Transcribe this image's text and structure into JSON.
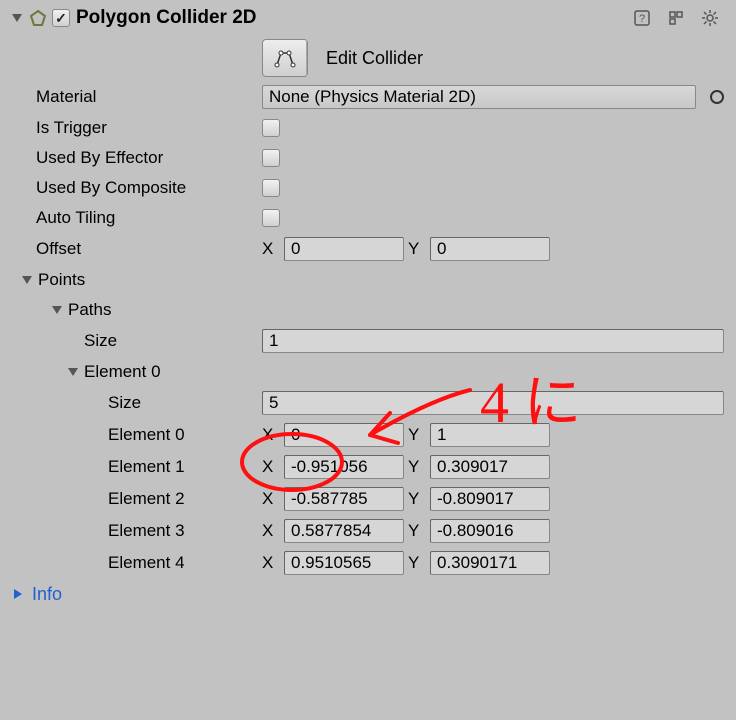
{
  "header": {
    "title": "Polygon Collider 2D",
    "enabled": true
  },
  "editCollider": {
    "label": "Edit Collider"
  },
  "material": {
    "label": "Material",
    "value": "None (Physics Material 2D)"
  },
  "isTrigger": {
    "label": "Is Trigger",
    "checked": false
  },
  "usedByEffector": {
    "label": "Used By Effector",
    "checked": false
  },
  "usedByComposite": {
    "label": "Used By Composite",
    "checked": false
  },
  "autoTiling": {
    "label": "Auto Tiling",
    "checked": false
  },
  "offset": {
    "label": "Offset",
    "x": "0",
    "y": "0"
  },
  "points": {
    "label": "Points",
    "paths": {
      "label": "Paths",
      "size": "1",
      "sizeLabel": "Size",
      "element0": {
        "label": "Element 0",
        "sizeLabel": "Size",
        "size": "5",
        "rows": [
          {
            "label": "Element 0",
            "x": "0",
            "y": "1"
          },
          {
            "label": "Element 1",
            "x": "-0.951056",
            "y": "0.309017"
          },
          {
            "label": "Element 2",
            "x": "-0.587785",
            "y": "-0.809017"
          },
          {
            "label": "Element 3",
            "x": "0.5877854",
            "y": "-0.809016"
          },
          {
            "label": "Element 4",
            "x": "0.9510565",
            "y": "0.3090171"
          }
        ]
      }
    }
  },
  "info": {
    "label": "Info"
  },
  "annot": {
    "text": "4 に"
  }
}
